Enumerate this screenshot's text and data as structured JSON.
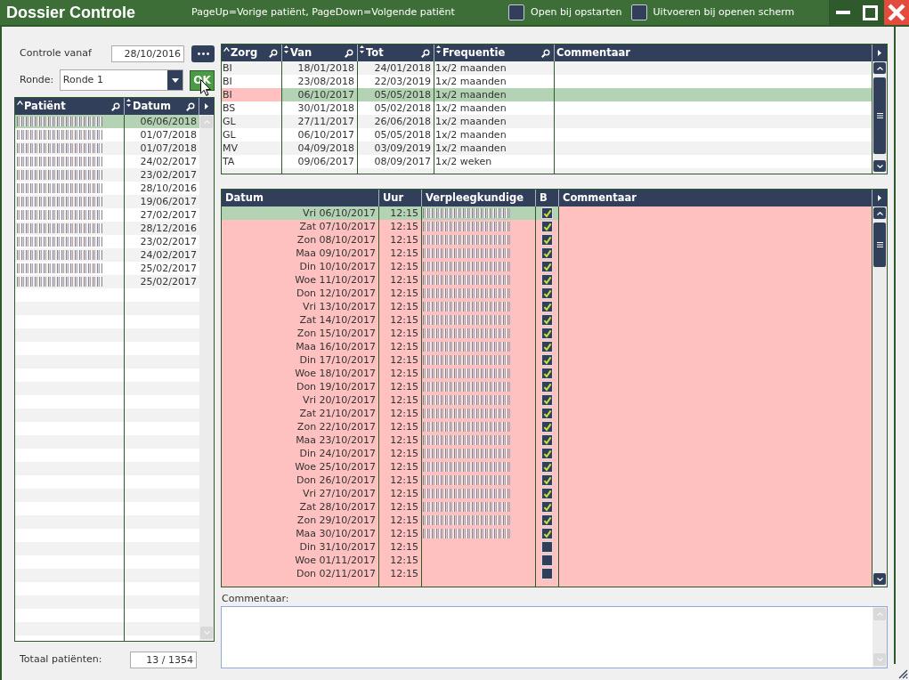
{
  "window": {
    "title": "Dossier Controle",
    "hint": "PageUp=Vorige patiënt, PageDown=Volgende patiënt",
    "options": [
      {
        "label": "Open bij opstarten",
        "checked": false
      },
      {
        "label": "Uitvoeren bij openen scherm",
        "checked": false
      }
    ]
  },
  "filter": {
    "start_label": "Controle vanaf",
    "start_value": "28/10/2016",
    "round_label": "Ronde:",
    "round_value": "Ronde 1",
    "ok_label": "OK"
  },
  "patients": {
    "columns": [
      {
        "label": "Patiënt",
        "kind": "sorted",
        "searchable": true
      },
      {
        "label": "Datum",
        "kind": "sortable",
        "searchable": true
      }
    ],
    "rows": [
      {
        "name_redacted": true,
        "date": "06/06/2018",
        "selected": true
      },
      {
        "name_redacted": true,
        "date": "01/07/2018",
        "selected": false
      },
      {
        "name_redacted": true,
        "date": "01/07/2018",
        "selected": false
      },
      {
        "name_redacted": true,
        "date": "24/02/2017",
        "selected": false
      },
      {
        "name_redacted": true,
        "date": "23/02/2017",
        "selected": false
      },
      {
        "name_redacted": true,
        "date": "28/10/2016",
        "selected": false
      },
      {
        "name_redacted": true,
        "date": "19/06/2017",
        "selected": false
      },
      {
        "name_redacted": true,
        "date": "27/02/2017",
        "selected": false
      },
      {
        "name_redacted": true,
        "date": "28/12/2016",
        "selected": false
      },
      {
        "name_redacted": true,
        "date": "23/02/2017",
        "selected": false
      },
      {
        "name_redacted": true,
        "date": "24/02/2017",
        "selected": false
      },
      {
        "name_redacted": true,
        "date": "25/02/2017",
        "selected": false
      },
      {
        "name_redacted": true,
        "date": "25/02/2017",
        "selected": false
      }
    ]
  },
  "total": {
    "label": "Totaal patiënten:",
    "value": "13 / 1354"
  },
  "care_table": {
    "columns": [
      {
        "label": "Zorg",
        "kind": "sorted",
        "searchable": true
      },
      {
        "label": "Van",
        "kind": "sortable",
        "searchable": true
      },
      {
        "label": "Tot",
        "kind": "sortable",
        "searchable": true
      },
      {
        "label": "Frequentie",
        "kind": "sortable",
        "searchable": true
      },
      {
        "label": "Commentaar",
        "kind": "plain",
        "searchable": false
      }
    ],
    "rows": [
      {
        "zorg": "BI",
        "van": "18/01/2018",
        "tot": "24/01/2018",
        "frequentie": "1x/2 maanden",
        "selected": false,
        "zorg_alert": false
      },
      {
        "zorg": "BI",
        "van": "23/08/2018",
        "tot": "22/03/2019",
        "frequentie": "1x/2 maanden",
        "selected": false,
        "zorg_alert": false
      },
      {
        "zorg": "BI",
        "van": "06/10/2017",
        "tot": "05/05/2018",
        "frequentie": "1x/2 maanden",
        "selected": true,
        "zorg_alert": true
      },
      {
        "zorg": "BS",
        "van": "30/01/2018",
        "tot": "05/02/2018",
        "frequentie": "1x/2 maanden",
        "selected": false,
        "zorg_alert": false
      },
      {
        "zorg": "GL",
        "van": "27/11/2017",
        "tot": "26/06/2018",
        "frequentie": "1x/2 maanden",
        "selected": false,
        "zorg_alert": false
      },
      {
        "zorg": "GL",
        "van": "06/10/2017",
        "tot": "05/05/2018",
        "frequentie": "1x/2 maanden",
        "selected": false,
        "zorg_alert": false
      },
      {
        "zorg": "MV",
        "van": "04/09/2018",
        "tot": "03/09/2019",
        "frequentie": "1x/2 maanden",
        "selected": false,
        "zorg_alert": false
      },
      {
        "zorg": "TA",
        "van": "09/06/2017",
        "tot": "08/09/2017",
        "frequentie": "1x/2 weken",
        "selected": false,
        "zorg_alert": false
      }
    ]
  },
  "controls_table": {
    "columns": [
      {
        "label": "Datum"
      },
      {
        "label": "Uur"
      },
      {
        "label": "Verpleegkundige"
      },
      {
        "label": "B"
      },
      {
        "label": "Commentaar"
      }
    ],
    "rows": [
      {
        "date": "Vri 06/10/2017",
        "time": "12:15",
        "nurse_redacted": true,
        "checked": true,
        "selected": true,
        "flagged": true
      },
      {
        "date": "Zat 07/10/2017",
        "time": "12:15",
        "nurse_redacted": true,
        "checked": true,
        "selected": false,
        "flagged": true
      },
      {
        "date": "Zon 08/10/2017",
        "time": "12:15",
        "nurse_redacted": true,
        "checked": true,
        "selected": false,
        "flagged": true
      },
      {
        "date": "Maa 09/10/2017",
        "time": "12:15",
        "nurse_redacted": true,
        "checked": true,
        "selected": false,
        "flagged": true
      },
      {
        "date": "Din 10/10/2017",
        "time": "12:15",
        "nurse_redacted": true,
        "checked": true,
        "selected": false,
        "flagged": true
      },
      {
        "date": "Woe 11/10/2017",
        "time": "12:15",
        "nurse_redacted": true,
        "checked": true,
        "selected": false,
        "flagged": true
      },
      {
        "date": "Don 12/10/2017",
        "time": "12:15",
        "nurse_redacted": true,
        "checked": true,
        "selected": false,
        "flagged": true
      },
      {
        "date": "Vri 13/10/2017",
        "time": "12:15",
        "nurse_redacted": true,
        "checked": true,
        "selected": false,
        "flagged": true
      },
      {
        "date": "Zat 14/10/2017",
        "time": "12:15",
        "nurse_redacted": true,
        "checked": true,
        "selected": false,
        "flagged": true
      },
      {
        "date": "Zon 15/10/2017",
        "time": "12:15",
        "nurse_redacted": true,
        "checked": true,
        "selected": false,
        "flagged": true
      },
      {
        "date": "Maa 16/10/2017",
        "time": "12:15",
        "nurse_redacted": true,
        "checked": true,
        "selected": false,
        "flagged": true
      },
      {
        "date": "Din 17/10/2017",
        "time": "12:15",
        "nurse_redacted": true,
        "checked": true,
        "selected": false,
        "flagged": true
      },
      {
        "date": "Woe 18/10/2017",
        "time": "12:15",
        "nurse_redacted": true,
        "checked": true,
        "selected": false,
        "flagged": true
      },
      {
        "date": "Don 19/10/2017",
        "time": "12:15",
        "nurse_redacted": true,
        "checked": true,
        "selected": false,
        "flagged": true
      },
      {
        "date": "Vri 20/10/2017",
        "time": "12:15",
        "nurse_redacted": true,
        "checked": true,
        "selected": false,
        "flagged": true
      },
      {
        "date": "Zat 21/10/2017",
        "time": "12:15",
        "nurse_redacted": true,
        "checked": true,
        "selected": false,
        "flagged": true
      },
      {
        "date": "Zon 22/10/2017",
        "time": "12:15",
        "nurse_redacted": true,
        "checked": true,
        "selected": false,
        "flagged": true
      },
      {
        "date": "Maa 23/10/2017",
        "time": "12:15",
        "nurse_redacted": true,
        "checked": true,
        "selected": false,
        "flagged": true
      },
      {
        "date": "Din 24/10/2017",
        "time": "12:15",
        "nurse_redacted": true,
        "checked": true,
        "selected": false,
        "flagged": true
      },
      {
        "date": "Woe 25/10/2017",
        "time": "12:15",
        "nurse_redacted": true,
        "checked": true,
        "selected": false,
        "flagged": true
      },
      {
        "date": "Don 26/10/2017",
        "time": "12:15",
        "nurse_redacted": true,
        "checked": true,
        "selected": false,
        "flagged": true
      },
      {
        "date": "Vri 27/10/2017",
        "time": "12:15",
        "nurse_redacted": true,
        "checked": true,
        "selected": false,
        "flagged": true
      },
      {
        "date": "Zat 28/10/2017",
        "time": "12:15",
        "nurse_redacted": true,
        "checked": true,
        "selected": false,
        "flagged": true
      },
      {
        "date": "Zon 29/10/2017",
        "time": "12:15",
        "nurse_redacted": true,
        "checked": true,
        "selected": false,
        "flagged": true
      },
      {
        "date": "Maa 30/10/2017",
        "time": "12:15",
        "nurse_redacted": true,
        "checked": true,
        "selected": false,
        "flagged": true
      },
      {
        "date": "Din 31/10/2017",
        "time": "12:15",
        "nurse_redacted": false,
        "checked": false,
        "selected": false,
        "flagged": true
      },
      {
        "date": "Woe 01/11/2017",
        "time": "12:15",
        "nurse_redacted": false,
        "checked": false,
        "selected": false,
        "flagged": true
      },
      {
        "date": "Don 02/11/2017",
        "time": "12:15",
        "nurse_redacted": false,
        "checked": false,
        "selected": false,
        "flagged": true
      }
    ]
  },
  "comment": {
    "label": "Commentaar:"
  }
}
